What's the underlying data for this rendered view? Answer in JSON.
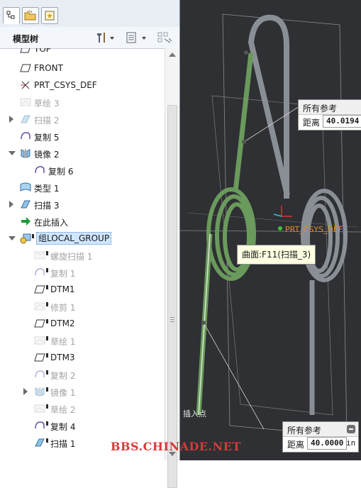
{
  "tree_panel": {
    "toolbar_title": "模型树",
    "items": [
      {
        "label": "TOP",
        "icon": "datum-plane-icon"
      },
      {
        "label": "FRONT",
        "icon": "datum-plane-icon"
      },
      {
        "label": "PRT_CSYS_DEF",
        "icon": "coordinate-system-icon"
      },
      {
        "label": "草绘 3",
        "icon": "sketch-icon"
      },
      {
        "label": "扫描 2",
        "icon": "sweep-icon"
      },
      {
        "label": "复制 5",
        "icon": "copy-surface-icon"
      },
      {
        "label": "镜像 2",
        "icon": "mirror-icon"
      },
      {
        "label": "复制 6",
        "icon": "copy-surface-icon"
      },
      {
        "label": "类型 1",
        "icon": "type-feature-icon"
      },
      {
        "label": "扫描 3",
        "icon": "sweep-icon"
      },
      {
        "label": "在此插入",
        "icon": "insert-here-arrow-icon"
      },
      {
        "label": "组LOCAL_GROUP",
        "icon": "group-icon"
      },
      {
        "label": "螺旋扫描 1",
        "icon": "helical-sweep-icon"
      },
      {
        "label": "复制 1",
        "icon": "copy-surface-icon"
      },
      {
        "label": "DTM1",
        "icon": "datum-plane-icon"
      },
      {
        "label": "修剪 1",
        "icon": "trim-icon"
      },
      {
        "label": "DTM2",
        "icon": "datum-plane-icon"
      },
      {
        "label": "草绘 1",
        "icon": "sketch-icon"
      },
      {
        "label": "DTM3",
        "icon": "datum-plane-icon"
      },
      {
        "label": "复制 2",
        "icon": "copy-surface-icon"
      },
      {
        "label": "镜像 1",
        "icon": "mirror-icon"
      },
      {
        "label": "草绘 2",
        "icon": "sketch-icon"
      },
      {
        "label": "复制 4",
        "icon": "copy-surface-icon"
      },
      {
        "label": "扫描 1",
        "icon": "sweep-icon"
      }
    ]
  },
  "viewport": {
    "callout_top": {
      "title": "所有参考",
      "distance_label": "距离",
      "distance_value": "40.0194"
    },
    "callout_bottom": {
      "title": "所有参考",
      "distance_label": "距离",
      "distance_value": "40.0000",
      "unit": "in"
    },
    "tooltip": "曲面:F11(扫描_3)",
    "csys_label": "PRT_CSYS_DEF",
    "insert_label": "插入点",
    "watermark": "BBS.CHINADE.NET"
  },
  "colors": {
    "viewport_bg": "#2e3033",
    "selected_geometry": "#6a9a5c",
    "spring_gray": "#8a8f96",
    "selection_highlight": "#cfe6ff",
    "watermark": "#d43b3b"
  }
}
